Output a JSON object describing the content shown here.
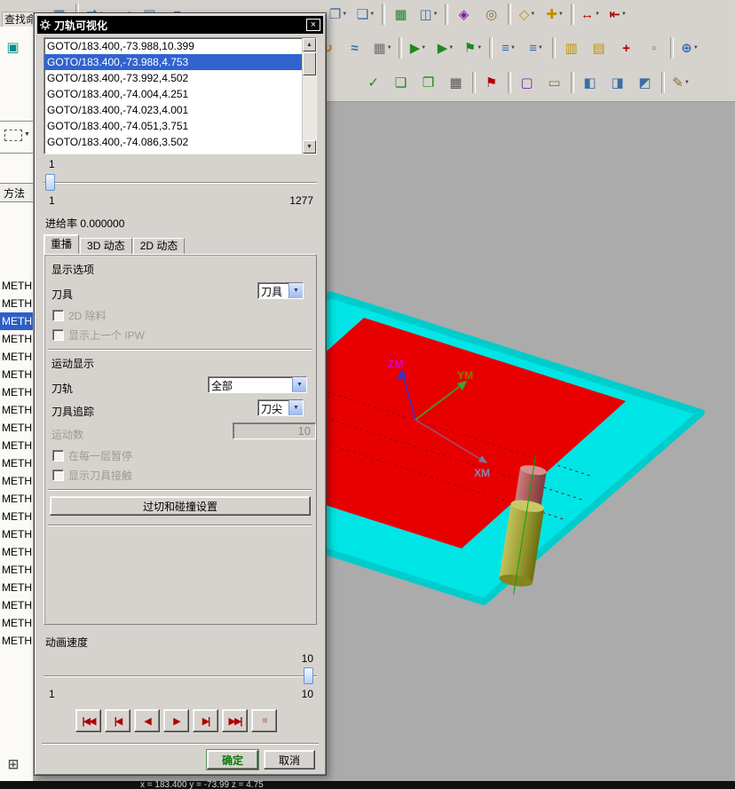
{
  "search": {
    "label": "查找命"
  },
  "toolbar": {
    "row1_left": [
      {
        "glyph": "▦",
        "color": "#3a6ea5",
        "name": "sketch-icon"
      },
      {
        "sep": true
      },
      {
        "glyph": "⇄",
        "color": "#3a6ea5",
        "caret": "▼",
        "name": "swap-view-icon"
      },
      {
        "glyph": "↔",
        "color": "#b00000",
        "caret": "▼",
        "name": "transform-icon"
      },
      {
        "glyph": "▤",
        "color": "#3a6ea5",
        "name": "layers-icon"
      },
      {
        "glyph": "≡",
        "color": "#3a6ea5",
        "name": "list-icon"
      }
    ],
    "row1_right": [
      {
        "glyph": "❐",
        "color": "#3a6ea5",
        "caret": "▼",
        "name": "copy-display-icon"
      },
      {
        "glyph": "❏",
        "color": "#3a6ea5",
        "caret": "▼",
        "name": "paste-display-icon"
      },
      {
        "sep": true
      },
      {
        "glyph": "▦",
        "color": "#2e7d32",
        "name": "spreadsheet-icon"
      },
      {
        "glyph": "◫",
        "color": "#3a6ea5",
        "caret": "▼",
        "name": "view-layout-icon"
      },
      {
        "sep": true
      },
      {
        "glyph": "◈",
        "color": "#7b1fa2",
        "name": "material-display-icon"
      },
      {
        "glyph": "◎",
        "color": "#8a6d3b",
        "name": "find-settings-icon"
      },
      {
        "sep": true
      },
      {
        "glyph": "◇",
        "color": "#c09000",
        "caret": "▼",
        "name": "snap-point-icon"
      },
      {
        "glyph": "✚",
        "color": "#c09000",
        "caret": "▼",
        "name": "datum-point-icon"
      },
      {
        "sep": true
      },
      {
        "glyph": "↔",
        "color": "#b00000",
        "caret": "▼",
        "name": "dimension-icon"
      },
      {
        "glyph": "⇤",
        "color": "#b00000",
        "caret": "▼",
        "name": "measure-icon"
      }
    ],
    "row2_left": [
      {
        "glyph": "▣",
        "color": "#0a8a8a",
        "name": "show-part-icon"
      },
      {
        "glyph": "▤",
        "color": "#0a8a8a",
        "name": "show-sheet-icon"
      }
    ],
    "row2_right": [
      {
        "glyph": "↻",
        "color": "#e07b00",
        "name": "rotate-view-icon"
      },
      {
        "glyph": "≈",
        "color": "#3a6ea5",
        "name": "spline-icon"
      },
      {
        "glyph": "▦",
        "color": "#707070",
        "caret": "▼",
        "name": "grid-plane-icon"
      },
      {
        "sep": true
      },
      {
        "glyph": "▶",
        "color": "#1c8a1c",
        "caret": "▼",
        "name": "generate-toolpath-icon"
      },
      {
        "glyph": "▶",
        "color": "#1c8a1c",
        "caret": "▼",
        "name": "replay-toolpath-icon"
      },
      {
        "glyph": "⚑",
        "color": "#1c8a1c",
        "caret": "▼",
        "name": "verify-toolpath-icon"
      },
      {
        "sep": true
      },
      {
        "glyph": "≡",
        "color": "#3a6ea5",
        "caret": "▼",
        "name": "operation-list-icon"
      },
      {
        "glyph": "≡",
        "color": "#3a6ea5",
        "caret": "▼",
        "name": "program-order-icon"
      },
      {
        "sep": true
      },
      {
        "glyph": "▥",
        "color": "#c09000",
        "name": "machine-tool-icon"
      },
      {
        "glyph": "▤",
        "color": "#c09000",
        "name": "geometry-view-icon"
      },
      {
        "glyph": "+",
        "color": "#b00000",
        "name": "create-operation-icon"
      },
      {
        "glyph": "▫",
        "color": "#707070",
        "name": "blank-icon"
      },
      {
        "sep": true
      },
      {
        "glyph": "⊕",
        "color": "#3a6ea5",
        "caret": "▼",
        "name": "insert-icon"
      }
    ],
    "row3": [
      {
        "glyph": "✓",
        "color": "#1c8a1c",
        "name": "verify-check-icon"
      },
      {
        "glyph": "❏",
        "color": "#1c8a1c",
        "name": "list-output-icon"
      },
      {
        "glyph": "❐",
        "color": "#1c8a1c",
        "name": "postprocess-icon"
      },
      {
        "glyph": "▦",
        "color": "#555555",
        "name": "shop-doc-icon"
      },
      {
        "sep": true
      },
      {
        "glyph": "⚑",
        "color": "#b00000",
        "name": "flag-icon"
      },
      {
        "sep": true
      },
      {
        "glyph": "▢",
        "color": "#7b1fa2",
        "name": "monitor-icon"
      },
      {
        "glyph": "▭",
        "color": "#8a6d3b",
        "name": "stock-icon"
      },
      {
        "sep": true
      },
      {
        "glyph": "◧",
        "color": "#3a6ea5",
        "name": "sync-left-icon"
      },
      {
        "glyph": "◨",
        "color": "#3a6ea5",
        "name": "sync-right-icon"
      },
      {
        "glyph": "◩",
        "color": "#3a6ea5",
        "name": "sync-both-icon"
      },
      {
        "sep": true
      },
      {
        "glyph": "✎",
        "color": "#8a6d3b",
        "caret": "▼",
        "name": "edit-settings-icon"
      }
    ]
  },
  "left_panel": {
    "method_label": "方法",
    "items": [
      {
        "text": "METH"
      },
      {
        "text": "METH"
      },
      {
        "text": "METH",
        "selected": true
      },
      {
        "text": "METH"
      },
      {
        "text": "METH"
      },
      {
        "text": "METH"
      },
      {
        "text": "METH"
      },
      {
        "text": "METH"
      },
      {
        "text": "METH"
      },
      {
        "text": "METH"
      },
      {
        "text": "METH"
      },
      {
        "text": "METH"
      },
      {
        "text": "METH"
      },
      {
        "text": "METH"
      },
      {
        "text": "METH"
      },
      {
        "text": "METH"
      },
      {
        "text": "METH"
      },
      {
        "text": "METH"
      },
      {
        "text": "METH"
      },
      {
        "text": "METH"
      },
      {
        "text": "METH"
      }
    ]
  },
  "dialog": {
    "title": "刀轨可视化",
    "close": "×",
    "goto_list": [
      {
        "text": "GOTO/183.400,-73.988,10.399"
      },
      {
        "text": "GOTO/183.400,-73.988,4.753",
        "selected": true
      },
      {
        "text": "GOTO/183.400,-73.992,4.502"
      },
      {
        "text": "GOTO/183.400,-74.004,4.251"
      },
      {
        "text": "GOTO/183.400,-74.023,4.001"
      },
      {
        "text": "GOTO/183.400,-74.051,3.751"
      },
      {
        "text": "GOTO/183.400,-74.086,3.502"
      }
    ],
    "position": {
      "current": "1",
      "min": "1",
      "max": "1277"
    },
    "feed_rate": "进给率 0.000000",
    "tabs": [
      {
        "label": "重播",
        "selected": true,
        "name": "tab-replay"
      },
      {
        "label": "3D 动态",
        "name": "tab-3d-dynamic"
      },
      {
        "label": "2D 动态",
        "name": "tab-2d-dynamic"
      }
    ],
    "display_options_label": "显示选项",
    "tool_label": "刀具",
    "tool_value": "刀具",
    "chk_2d_removal": "2D 除料",
    "chk_show_ipw": "显示上一个 IPW",
    "motion_display_label": "运动显示",
    "toolpath_label": "刀轨",
    "toolpath_value": "全部",
    "tool_track_label": "刀具追踪",
    "tool_track_value": "刀尖",
    "motion_count_label": "运动数",
    "motion_count_value": "10",
    "chk_pause_layer": "在每一层暂停",
    "chk_tool_contact": "显示刀具接触",
    "gouge_button": "过切和碰撞设置",
    "anim_label": "动画速度",
    "anim_value": "10",
    "anim_min": "1",
    "anim_max": "10",
    "playback": [
      {
        "glyph": "|◀◀",
        "color": "#b00000",
        "name": "play-to-start-button"
      },
      {
        "glyph": "|◀",
        "color": "#b00000",
        "name": "step-back-button"
      },
      {
        "glyph": "◀",
        "color": "#b00000",
        "name": "play-backward-button"
      },
      {
        "glyph": "▶",
        "color": "#b00000",
        "name": "play-forward-button"
      },
      {
        "glyph": "▶|",
        "color": "#b00000",
        "name": "step-forward-button"
      },
      {
        "glyph": "▶▶|",
        "color": "#b00000",
        "name": "play-to-end-button"
      },
      {
        "glyph": "■",
        "color": "#c49a9a",
        "name": "stop-button"
      }
    ],
    "ok": "确定",
    "cancel": "取消"
  },
  "viewport": {
    "axis_z": "ZM",
    "axis_y": "YM",
    "axis_x": "XM"
  },
  "statusbar": {
    "coords": "x = 183.400   y = -73.99   z = 4.75"
  },
  "colors": {
    "toolpath": "#00e5e5",
    "surface": "#e80000",
    "selection": "#3163ce"
  }
}
